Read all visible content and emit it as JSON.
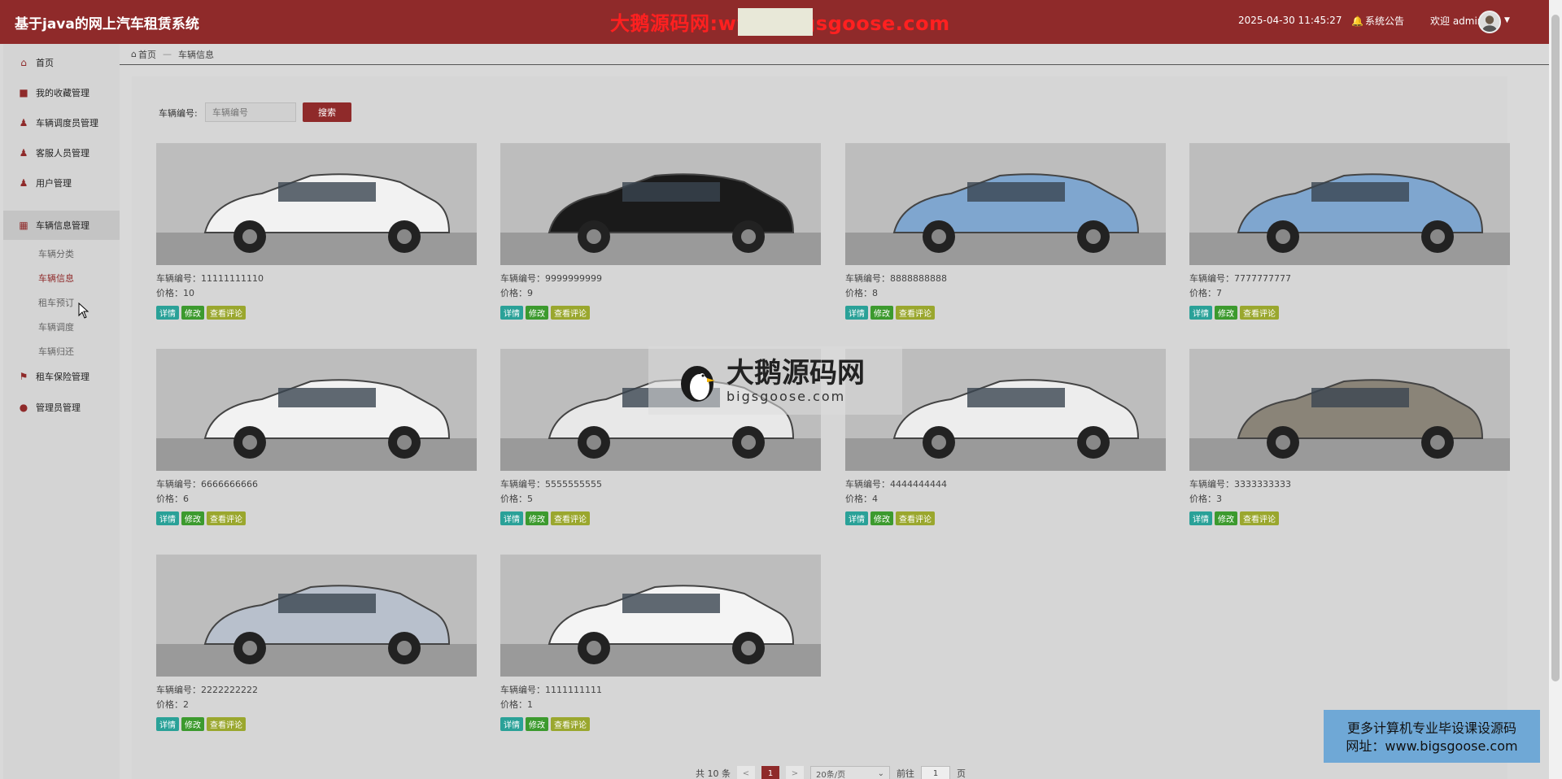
{
  "header": {
    "title": "基于java的网上汽车租赁系统",
    "watermark": "大鹅源码网:www.bigsgoose.com",
    "datetime": "2025-04-30 11:45:27",
    "notice_label": "系统公告",
    "welcome": "欢迎 admin"
  },
  "sidebar": {
    "items": [
      {
        "label": "首页",
        "icon": "home-icon"
      },
      {
        "label": "我的收藏管理",
        "icon": "collection-icon"
      },
      {
        "label": "车辆调度员管理",
        "icon": "user-icon"
      },
      {
        "label": "客服人员管理",
        "icon": "user-icon"
      },
      {
        "label": "用户管理",
        "icon": "user-icon"
      },
      {
        "label": "车辆信息管理",
        "icon": "grid-icon"
      },
      {
        "label": "租车保险管理",
        "icon": "car-icon"
      },
      {
        "label": "管理员管理",
        "icon": "admin-icon"
      }
    ],
    "submenu": [
      {
        "label": "车辆分类"
      },
      {
        "label": "车辆信息"
      },
      {
        "label": "租车预订"
      },
      {
        "label": "车辆调度"
      },
      {
        "label": "车辆归还"
      }
    ]
  },
  "breadcrumb": {
    "home": "首页",
    "current": "车辆信息"
  },
  "search": {
    "label": "车辆编号:",
    "placeholder": "车辆编号",
    "button": "搜索"
  },
  "cards": [
    {
      "id": "车辆编号：11111111110",
      "price": "价格：10",
      "color": "#f2f2f2"
    },
    {
      "id": "车辆编号：9999999999",
      "price": "价格：9",
      "color": "#1a1a1a"
    },
    {
      "id": "车辆编号：8888888888",
      "price": "价格：8",
      "color": "#7fa6cf"
    },
    {
      "id": "车辆编号：7777777777",
      "price": "价格：7",
      "color": "#7fa6cf"
    },
    {
      "id": "车辆编号：6666666666",
      "price": "价格：6",
      "color": "#f2f2f2"
    },
    {
      "id": "车辆编号：5555555555",
      "price": "价格：5",
      "color": "#e8e8e8"
    },
    {
      "id": "车辆编号：4444444444",
      "price": "价格：4",
      "color": "#ededed"
    },
    {
      "id": "车辆编号：3333333333",
      "price": "价格：3",
      "color": "#8a8478"
    },
    {
      "id": "车辆编号：2222222222",
      "price": "价格：2",
      "color": "#b8c0cc"
    },
    {
      "id": "车辆编号：1111111111",
      "price": "价格：1",
      "color": "#f4f4f4"
    }
  ],
  "card_actions": {
    "detail": "详情",
    "edit": "修改",
    "comments": "查看评论"
  },
  "center_watermark": {
    "main": "大鹅源码网",
    "sub": "bigsgoose.com"
  },
  "ad": {
    "line1": "更多计算机专业毕设课设源码",
    "line2": "网址：www.bigsgoose.com"
  },
  "pagination": {
    "total": "共 10 条",
    "prev": "<",
    "current": "1",
    "next": ">",
    "page_size": "20条/页",
    "goto_label": "前往",
    "goto_value": "1",
    "page_unit": "页"
  },
  "colors": {
    "brand": "#8f2a2a",
    "detail_btn": "#2aa198",
    "edit_btn": "#3c9a2e",
    "comment_btn": "#9aa72e"
  }
}
